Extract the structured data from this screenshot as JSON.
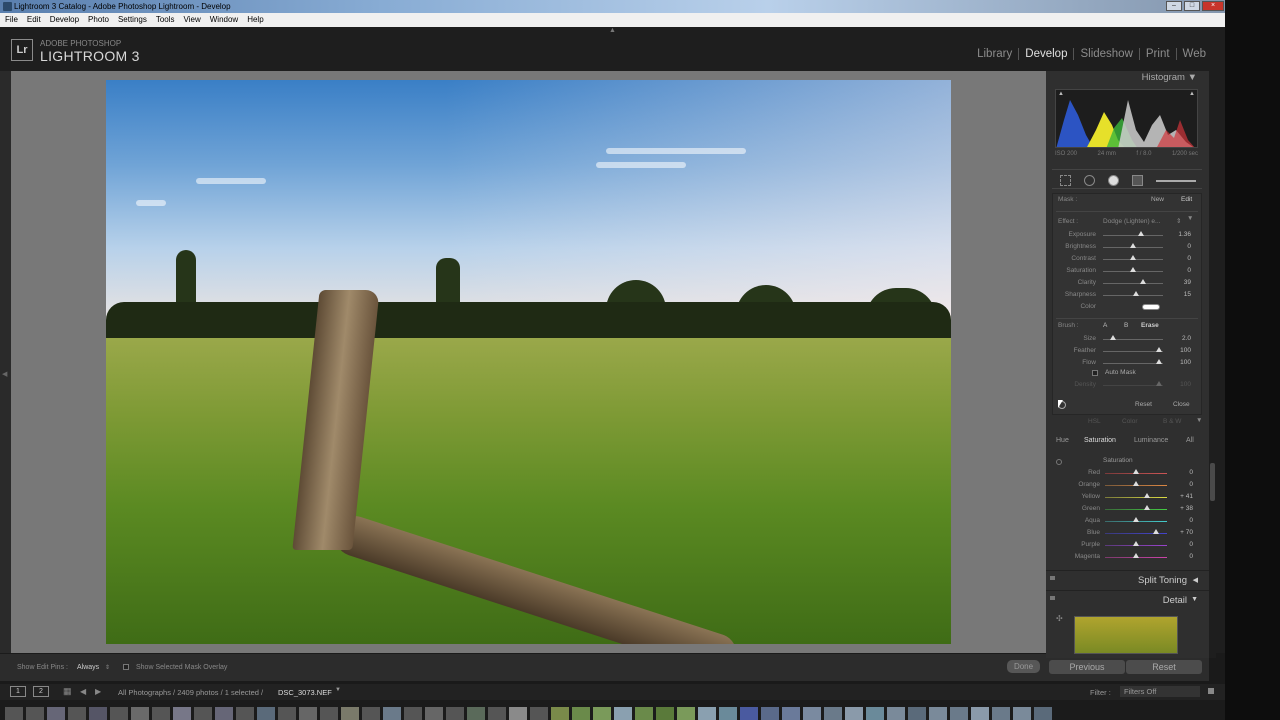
{
  "window": {
    "title": "Lightroom 3 Catalog - Adobe Photoshop Lightroom - Develop"
  },
  "menu": [
    "File",
    "Edit",
    "Develop",
    "Photo",
    "Settings",
    "Tools",
    "View",
    "Window",
    "Help"
  ],
  "brand": {
    "logo": "Lr",
    "line1": "ADOBE PHOTOSHOP",
    "line2": "LIGHTROOM 3"
  },
  "modules": [
    "Library",
    "Develop",
    "Slideshow",
    "Print",
    "Web"
  ],
  "active_module": "Develop",
  "histogram": {
    "title": "Histogram",
    "iso": "ISO 200",
    "focal": "24 mm",
    "aperture": "f / 8.0",
    "shutter": "1/200 sec"
  },
  "mask": {
    "label": "Mask :",
    "new": "New",
    "edit": "Edit"
  },
  "effect": {
    "label": "Effect :",
    "value": "Dodge (Lighten) e...",
    "rows": [
      {
        "label": "Exposure",
        "value": "1.36",
        "level": 0.76
      },
      {
        "label": "Brightness",
        "value": "0",
        "level": 0.5
      },
      {
        "label": "Contrast",
        "value": "0",
        "level": 0.5
      },
      {
        "label": "Saturation",
        "value": "0",
        "level": 0.5
      },
      {
        "label": "Clarity",
        "value": "39",
        "level": 0.7
      },
      {
        "label": "Sharpness",
        "value": "15",
        "level": 0.58
      }
    ],
    "color_label": "Color"
  },
  "brush": {
    "label": "Brush :",
    "a": "A",
    "b": "B",
    "erase": "Erase",
    "rows": [
      {
        "label": "Size",
        "value": "2.0",
        "level": 0.17
      },
      {
        "label": "Feather",
        "value": "100",
        "level": 1.0
      },
      {
        "label": "Flow",
        "value": "100",
        "level": 1.0
      }
    ],
    "auto_mask": "Auto Mask",
    "density_label": "Density",
    "density_value": "100",
    "reset": "Reset",
    "close": "Close"
  },
  "hsl": {
    "tabs_partial": [
      "HSL",
      "Color",
      "B & W"
    ],
    "tabs": [
      "Hue",
      "Saturation",
      "Luminance",
      "All"
    ],
    "active_tab": "Saturation",
    "group": "Saturation",
    "rows": [
      {
        "label": "Red",
        "value": "0",
        "level": 0.5
      },
      {
        "label": "Orange",
        "value": "0",
        "level": 0.5
      },
      {
        "label": "Yellow",
        "value": "+ 41",
        "level": 0.7
      },
      {
        "label": "Green",
        "value": "+ 38",
        "level": 0.69
      },
      {
        "label": "Aqua",
        "value": "0",
        "level": 0.5
      },
      {
        "label": "Blue",
        "value": "+ 70",
        "level": 0.85
      },
      {
        "label": "Purple",
        "value": "0",
        "level": 0.5
      },
      {
        "label": "Magenta",
        "value": "0",
        "level": 0.5
      }
    ]
  },
  "sections": {
    "split_toning": "Split Toning",
    "detail": "Detail"
  },
  "toolbar": {
    "show_edit_pins": "Show Edit Pins :",
    "pins_value": "Always",
    "show_mask": "Show Selected Mask Overlay",
    "done": "Done"
  },
  "panel_buttons": {
    "previous": "Previous",
    "reset": "Reset"
  },
  "filmstrip_bar": {
    "page1": "1",
    "page2": "2",
    "source": "All Photographs / 2409 photos / 1 selected /",
    "filename": "DSC_3073.NEF",
    "filter_label": "Filter :",
    "filter_value": "Filters Off"
  },
  "colors": {
    "accent_bg": "#2f2f2f",
    "canvas": "#787878",
    "active_text": "#e0e0e0"
  }
}
